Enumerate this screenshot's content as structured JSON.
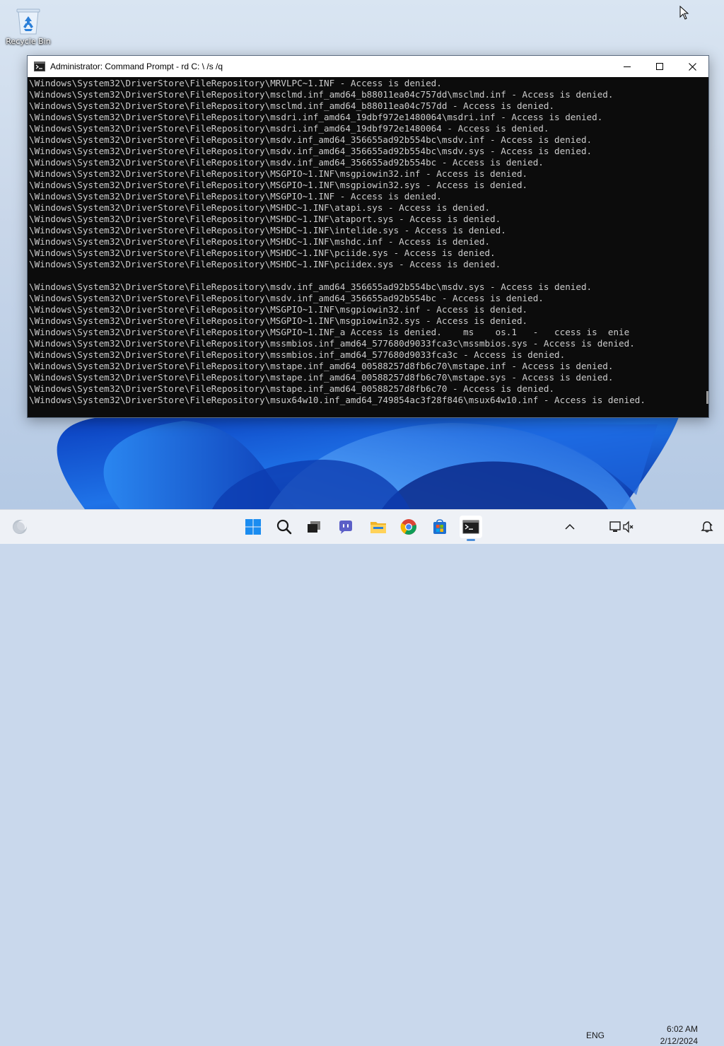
{
  "desktop": {
    "icons": [
      {
        "label": "Recycle Bin",
        "icon": "recycle-bin-icon"
      }
    ]
  },
  "window": {
    "title": "Administrator: Command Prompt - rd  C: \\ /s /q",
    "app_icon": "command-prompt-icon",
    "controls": {
      "minimize": "minimize-icon",
      "maximize": "maximize-icon",
      "close": "close-icon"
    }
  },
  "console": {
    "lines": [
      "\\Windows\\System32\\DriverStore\\FileRepository\\MRVLPC~1.INF - Access is denied.",
      "\\Windows\\System32\\DriverStore\\FileRepository\\msclmd.inf_amd64_b88011ea04c757dd\\msclmd.inf - Access is denied.",
      "\\Windows\\System32\\DriverStore\\FileRepository\\msclmd.inf_amd64_b88011ea04c757dd - Access is denied.",
      "\\Windows\\System32\\DriverStore\\FileRepository\\msdri.inf_amd64_19dbf972e1480064\\msdri.inf - Access is denied.",
      "\\Windows\\System32\\DriverStore\\FileRepository\\msdri.inf_amd64_19dbf972e1480064 - Access is denied.",
      "\\Windows\\System32\\DriverStore\\FileRepository\\msdv.inf_amd64_356655ad92b554bc\\msdv.inf - Access is denied.",
      "\\Windows\\System32\\DriverStore\\FileRepository\\msdv.inf_amd64_356655ad92b554bc\\msdv.sys - Access is denied.",
      "\\Windows\\System32\\DriverStore\\FileRepository\\msdv.inf_amd64_356655ad92b554bc - Access is denied.",
      "\\Windows\\System32\\DriverStore\\FileRepository\\MSGPIO~1.INF\\msgpiowin32.inf - Access is denied.",
      "\\Windows\\System32\\DriverStore\\FileRepository\\MSGPIO~1.INF\\msgpiowin32.sys - Access is denied.",
      "\\Windows\\System32\\DriverStore\\FileRepository\\MSGPIO~1.INF - Access is denied.",
      "\\Windows\\System32\\DriverStore\\FileRepository\\MSHDC~1.INF\\atapi.sys - Access is denied.",
      "\\Windows\\System32\\DriverStore\\FileRepository\\MSHDC~1.INF\\ataport.sys - Access is denied.",
      "\\Windows\\System32\\DriverStore\\FileRepository\\MSHDC~1.INF\\intelide.sys - Access is denied.",
      "\\Windows\\System32\\DriverStore\\FileRepository\\MSHDC~1.INF\\mshdc.inf - Access is denied.",
      "\\Windows\\System32\\DriverStore\\FileRepository\\MSHDC~1.INF\\pciide.sys - Access is denied.",
      "\\Windows\\System32\\DriverStore\\FileRepository\\MSHDC~1.INF\\pciidex.sys - Access is denied.",
      "",
      "\\Windows\\System32\\DriverStore\\FileRepository\\msdv.inf_amd64_356655ad92b554bc\\msdv.sys - Access is denied.",
      "\\Windows\\System32\\DriverStore\\FileRepository\\msdv.inf_amd64_356655ad92b554bc - Access is denied.",
      "\\Windows\\System32\\DriverStore\\FileRepository\\MSGPIO~1.INF\\msgpiowin32.inf - Access is denied.",
      "\\Windows\\System32\\DriverStore\\FileRepository\\MSGPIO~1.INF\\msgpiowin32.sys - Access is denied.",
      "\\Windows\\System32\\DriverStore\\FileRepository\\MSGPIO~1.INF_a Access is denied.    ms    os.1   -   ccess is  enie",
      "\\Windows\\System32\\DriverStore\\FileRepository\\mssmbios.inf_amd64_577680d9033fca3c\\mssmbios.sys - Access is denied.",
      "\\Windows\\System32\\DriverStore\\FileRepository\\mssmbios.inf_amd64_577680d9033fca3c - Access is denied.",
      "\\Windows\\System32\\DriverStore\\FileRepository\\mstape.inf_amd64_00588257d8fb6c70\\mstape.inf - Access is denied.",
      "\\Windows\\System32\\DriverStore\\FileRepository\\mstape.inf_amd64_00588257d8fb6c70\\mstape.sys - Access is denied.",
      "\\Windows\\System32\\DriverStore\\FileRepository\\mstape.inf_amd64_00588257d8fb6c70 - Access is denied.",
      "\\Windows\\System32\\DriverStore\\FileRepository\\msux64w10.inf_amd64_749854ac3f28f846\\msux64w10.inf - Access is denied."
    ],
    "text_color": "#cccccc",
    "background": "#0c0c0c"
  },
  "taskbar": {
    "widgets_icon": "weather-widget-icon",
    "pinned": [
      {
        "name": "start",
        "icon": "windows-start-icon"
      },
      {
        "name": "search",
        "icon": "search-icon"
      },
      {
        "name": "task-view",
        "icon": "task-view-icon"
      },
      {
        "name": "chat",
        "icon": "chat-icon"
      },
      {
        "name": "file-explorer",
        "icon": "folder-icon"
      },
      {
        "name": "chrome",
        "icon": "chrome-icon"
      },
      {
        "name": "store",
        "icon": "store-icon"
      },
      {
        "name": "terminal",
        "icon": "command-prompt-icon",
        "active": true
      }
    ],
    "tray": {
      "overflow_icon": "chevron-up-icon",
      "language": "ENG",
      "network_icon": "network-icon",
      "volume_icon": "volume-muted-icon",
      "time": "6:02 AM",
      "date": "2/12/2024",
      "notification_icon": "notification-icon"
    }
  },
  "colors": {
    "accent": "#0078d4",
    "wallpaper_blue": "#1565d8"
  }
}
